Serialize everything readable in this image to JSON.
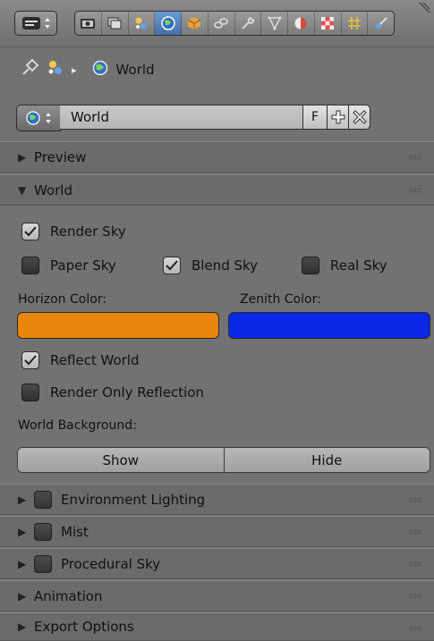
{
  "toolbar": {
    "editor_type_icon": "properties-editor-icon",
    "tabs": [
      {
        "name": "render-icon",
        "active": false
      },
      {
        "name": "render-layers-icon",
        "active": false
      },
      {
        "name": "scene-icon",
        "active": false
      },
      {
        "name": "world-icon",
        "active": true
      },
      {
        "name": "object-icon",
        "active": false
      },
      {
        "name": "constraints-icon",
        "active": false
      },
      {
        "name": "modifiers-icon",
        "active": false
      },
      {
        "name": "object-data-icon",
        "active": false
      },
      {
        "name": "material-icon",
        "active": false
      },
      {
        "name": "texture-icon",
        "active": false
      },
      {
        "name": "particles-icon",
        "active": false
      },
      {
        "name": "physics-icon",
        "active": false
      }
    ]
  },
  "breadcrumb": {
    "pin_icon": "pin-icon",
    "scene_icon": "scene-icon",
    "separator": "▸",
    "world_label": "World"
  },
  "datablock": {
    "name": "World",
    "fake_user": "F",
    "add_symbol": "+",
    "remove_symbol": "✕"
  },
  "panels": {
    "preview": "Preview",
    "world": "World",
    "environment_lighting": "Environment Lighting",
    "mist": "Mist",
    "procedural_sky": "Procedural Sky",
    "animation": "Animation",
    "export_options": "Export Options"
  },
  "world": {
    "render_sky": {
      "label": "Render Sky",
      "checked": true
    },
    "paper_sky": {
      "label": "Paper Sky",
      "checked": false
    },
    "blend_sky": {
      "label": "Blend Sky",
      "checked": true
    },
    "real_sky": {
      "label": "Real Sky",
      "checked": false
    },
    "horizon_label": "Horizon Color:",
    "zenith_label": "Zenith Color:",
    "horizon_color": "#e8850a",
    "zenith_color": "#0a28e6",
    "reflect_world": {
      "label": "Reflect World",
      "checked": true
    },
    "render_only_reflection": {
      "label": "Render Only Reflection",
      "checked": false
    },
    "world_background_label": "World Background:",
    "show_label": "Show",
    "hide_label": "Hide"
  },
  "colors": {
    "panel_bg": "#727272",
    "active_tab": "#5a86bd"
  }
}
